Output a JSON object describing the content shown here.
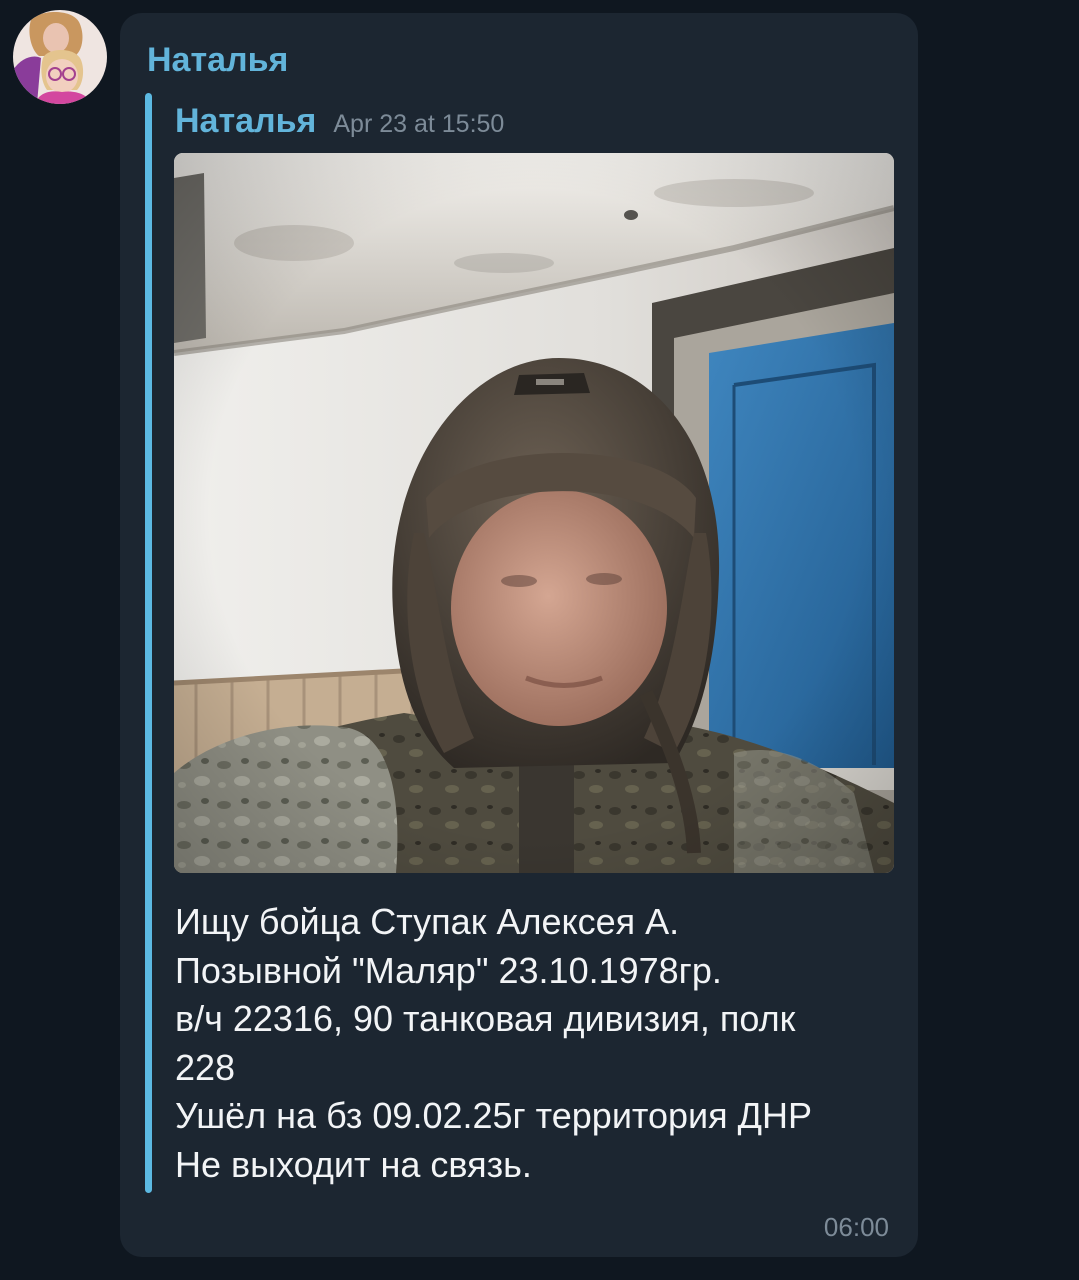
{
  "chat": {
    "sender_name": "Наталья"
  },
  "forward": {
    "from_name": "Наталья",
    "date": "Apr 23 at 15:50"
  },
  "message": {
    "text_lines": [
      "Ищу бойца Ступак Алексея А.",
      "Позывной \"Маляр\" 23.10.1978гр.",
      "в/ч 22316, 90 танковая дивизия, полк",
      "228",
      "Ушёл на бз 09.02.25г территория ДНР",
      "Не выходит на связь."
    ],
    "time": "06:00"
  },
  "colors": {
    "background": "#0f1720",
    "bubble": "#1c2631",
    "name": "#62b4da",
    "quote_bar": "#5cb9e2",
    "text": "#f2f4f6",
    "meta": "#7d8b98"
  }
}
